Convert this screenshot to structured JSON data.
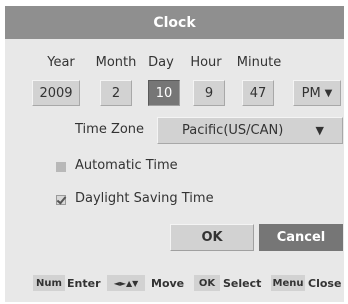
{
  "title": "Clock",
  "datetime": {
    "labels": {
      "year": "Year",
      "month": "Month",
      "day": "Day",
      "hour": "Hour",
      "minute": "Minute"
    },
    "values": {
      "year": "2009",
      "month": "2",
      "day": "10",
      "hour": "9",
      "minute": "47",
      "ampm": "PM"
    }
  },
  "timezone": {
    "label": "Time Zone",
    "value": "Pacific(US/CAN)"
  },
  "options": {
    "automatic_time": {
      "label": "Automatic Time",
      "checked": false
    },
    "daylight_saving": {
      "label": "Daylight Saving Time",
      "checked": true
    }
  },
  "buttons": {
    "ok": "OK",
    "cancel": "Cancel"
  },
  "footer": {
    "num_key": "Num",
    "num_action": "Enter",
    "arrows_key": "◄►▲▼",
    "arrows_action": "Move",
    "ok_key": "OK",
    "ok_action": "Select",
    "menu_key": "Menu",
    "menu_action": "Close"
  },
  "icons": {
    "dropdown": "chevron-down-icon",
    "check": "checkmark-icon"
  }
}
